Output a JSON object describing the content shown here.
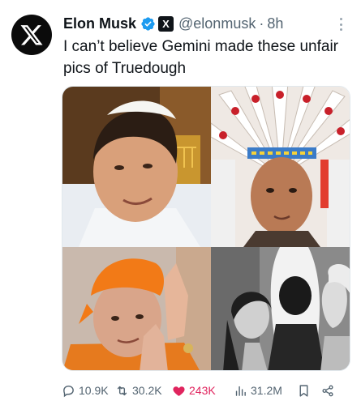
{
  "author": {
    "name": "Elon Musk",
    "handle": "@elonmusk",
    "separator": "·",
    "time": "8h",
    "avatar_icon": "x-logo-icon",
    "verified_icon": "verified-badge-icon",
    "affiliation_icon": "x-affiliate-badge-icon",
    "affiliation_label": "X"
  },
  "tweet": {
    "text": "I can’t believe Gemini made these unfair pics of Truedough"
  },
  "media": {
    "count": 4
  },
  "actions": {
    "reply": {
      "icon": "reply-icon",
      "count": "10.9K"
    },
    "retweet": {
      "icon": "retweet-icon",
      "count": "30.2K"
    },
    "like": {
      "icon": "heart-icon",
      "count": "243K",
      "color": "#e0245e"
    },
    "views": {
      "icon": "views-icon",
      "count": "31.2M"
    },
    "bookmark": {
      "icon": "bookmark-icon"
    },
    "share": {
      "icon": "share-icon"
    }
  },
  "colors": {
    "text": "#0f1419",
    "secondary": "#536471",
    "verified": "#1d9bf0",
    "like": "#e0245e"
  }
}
